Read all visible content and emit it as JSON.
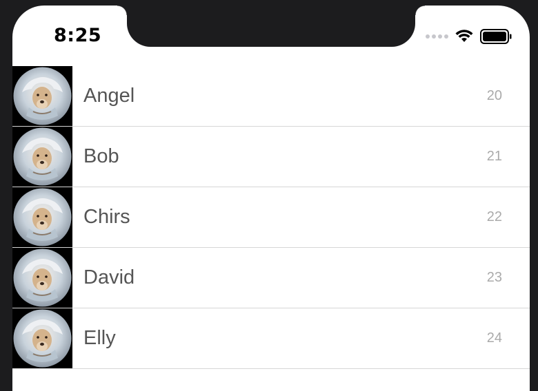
{
  "status_bar": {
    "time": "8:25",
    "icons": [
      "signal-dots-icon",
      "wifi-icon",
      "battery-icon"
    ]
  },
  "list": {
    "items": [
      {
        "name": "Angel",
        "age": "20",
        "avatar": "dog-avatar-icon"
      },
      {
        "name": "Bob",
        "age": "21",
        "avatar": "dog-avatar-icon"
      },
      {
        "name": "Chirs",
        "age": "22",
        "avatar": "dog-avatar-icon"
      },
      {
        "name": "David",
        "age": "23",
        "avatar": "dog-avatar-icon"
      },
      {
        "name": "Elly",
        "age": "24",
        "avatar": "dog-avatar-icon"
      }
    ]
  },
  "colors": {
    "background": "#1c1c1e",
    "screen": "#ffffff",
    "name_text": "#555555",
    "age_text": "#aaaaaa",
    "separator": "#d6d6d6"
  }
}
